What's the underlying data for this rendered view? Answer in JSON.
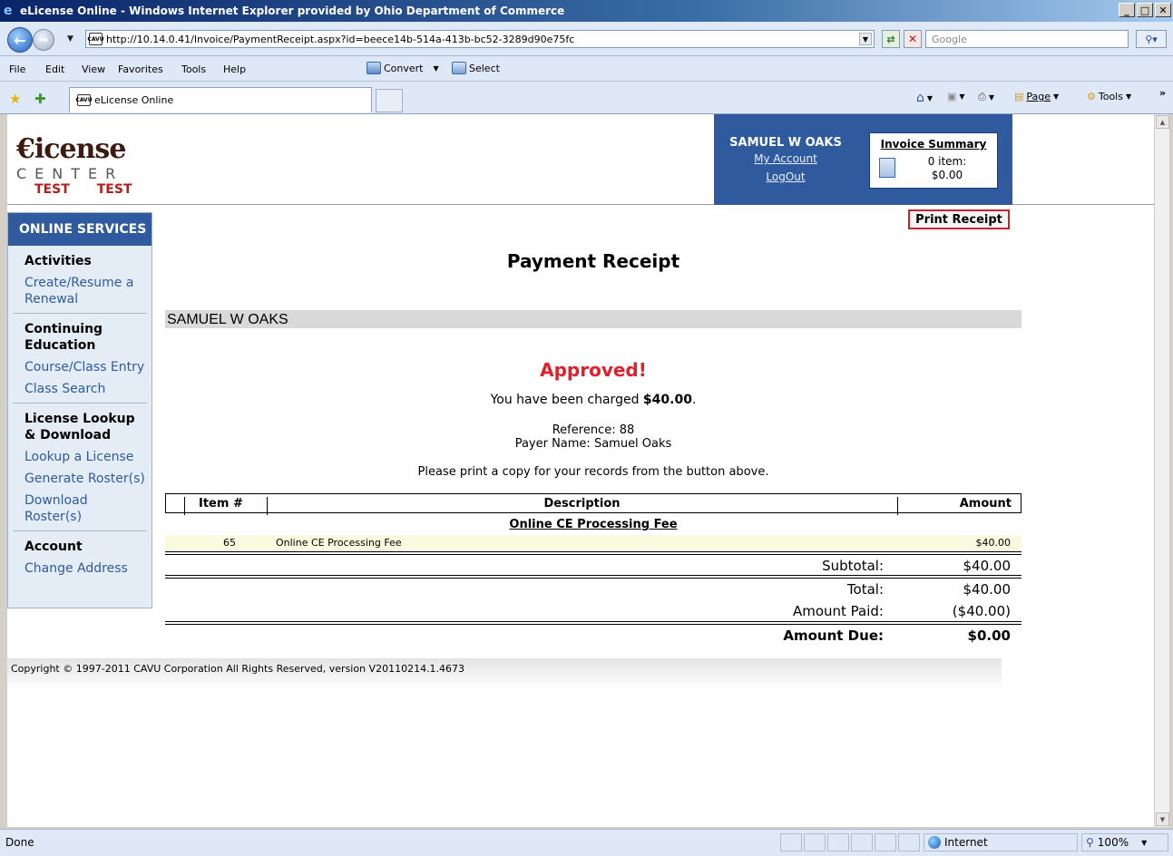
{
  "window": {
    "title": "eLicense Online - Windows Internet Explorer provided by Ohio Department of Commerce",
    "controls": [
      "_",
      "□",
      "✕"
    ]
  },
  "address_bar": {
    "url": "http://10.14.0.41/Invoice/PaymentReceipt.aspx?id=beece14b-514a-413b-bc52-3289d90e75fc",
    "favicon_text": "CAVU",
    "search_placeholder": "Google"
  },
  "menu": {
    "items": [
      "File",
      "Edit",
      "View",
      "Favorites",
      "Tools",
      "Help"
    ],
    "convert_label": "Convert",
    "select_label": "Select"
  },
  "tabs": {
    "active_label": "eLicense Online",
    "favicon_text": "CAVU"
  },
  "commandbar": {
    "page_label": "Page",
    "tools_label": "Tools",
    "more": "»"
  },
  "logo": {
    "main": "€icense",
    "sub": "CENTER",
    "test_left": "TEST",
    "test_right": "TEST"
  },
  "user": {
    "name": "SAMUEL W OAKS",
    "my_account": "My Account",
    "logout": "LogOut"
  },
  "invoice_summary": {
    "title": "Invoice Summary",
    "item_count": "0 item:",
    "total": "$0.00"
  },
  "sidebar": {
    "heading": "ONLINE SERVICES",
    "groups": [
      {
        "title": "Activities",
        "links": [
          "Create/Resume a Renewal"
        ]
      },
      {
        "title": "Continuing Education",
        "links": [
          "Course/Class Entry",
          "Class Search"
        ]
      },
      {
        "title": "License Lookup & Download",
        "links": [
          "Lookup a License",
          "Generate Roster(s)",
          "Download Roster(s)"
        ]
      },
      {
        "title": "Account",
        "links": [
          "Change Address"
        ]
      }
    ]
  },
  "receipt": {
    "print_button": "Print Receipt",
    "title": "Payment Receipt",
    "payer_banner": "SAMUEL W OAKS",
    "status": "Approved!",
    "charged_prefix": "You have been charged ",
    "charged_amount": "$40.00",
    "charged_suffix": ".",
    "reference": "Reference: 88",
    "payer_name": "Payer Name: Samuel Oaks",
    "instruction": "Please print a copy for your records from the button above.",
    "columns": {
      "item": "Item #",
      "description": "Description",
      "amount": "Amount"
    },
    "section": "Online CE Processing Fee",
    "line_items": [
      {
        "item": "65",
        "description": "Online CE Processing Fee",
        "amount": "$40.00"
      }
    ],
    "subtotal_label": "Subtotal:",
    "subtotal_value": "$40.00",
    "total_label": "Total:",
    "total_value": "$40.00",
    "paid_label": "Amount Paid:",
    "paid_value": "($40.00)",
    "due_label": "Amount Due:",
    "due_value": "$0.00"
  },
  "footer": {
    "copyright": "Copyright © 1997-2011 CAVU Corporation All Rights Reserved, version V20110214.1.4673"
  },
  "statusbar": {
    "status": "Done",
    "zone": "Internet",
    "zoom": "100%"
  },
  "colors": {
    "brand_blue": "#2f5b9e",
    "approved_red": "#e0202a",
    "link_blue": "#2f5b9e",
    "logo_test_red": "#b41e1e"
  }
}
